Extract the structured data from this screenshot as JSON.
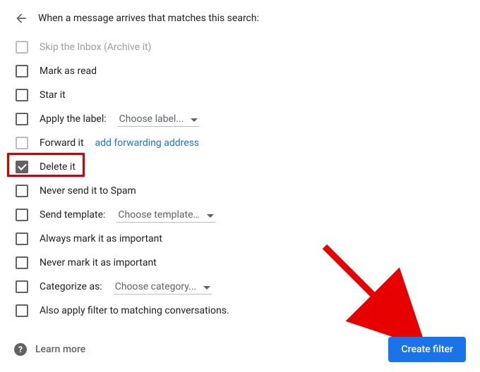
{
  "header": {
    "text": "When a message arrives that matches this search:"
  },
  "options": {
    "skip_inbox": "Skip the Inbox (Archive it)",
    "mark_read": "Mark as read",
    "star": "Star it",
    "apply_label": "Apply the label:",
    "apply_label_dropdown": "Choose label...",
    "forward": "Forward it",
    "forward_link": "add forwarding address",
    "delete": "Delete it",
    "never_spam": "Never send it to Spam",
    "send_template": "Send template:",
    "send_template_dropdown": "Choose template…",
    "always_important": "Always mark it as important",
    "never_important": "Never mark it as important",
    "categorize": "Categorize as:",
    "categorize_dropdown": "Choose category...",
    "also_apply": "Also apply filter to matching conversations."
  },
  "footer": {
    "learn_more": "Learn more",
    "create_filter": "Create filter"
  }
}
